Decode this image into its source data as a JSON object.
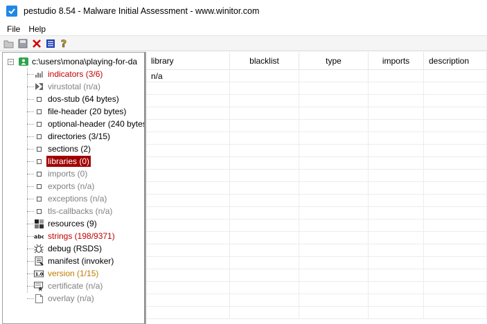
{
  "window": {
    "title": "pestudio 8.54 - Malware Initial Assessment - www.winitor.com"
  },
  "menu": [
    "File",
    "Help"
  ],
  "toolbar": {
    "buttons": [
      "open-icon",
      "save-icon",
      "close-icon",
      "list-icon",
      "help-icon"
    ]
  },
  "tree": {
    "root_label": "c:\\users\\mona\\playing-for-da",
    "items": [
      {
        "label": "indicators (3/6)",
        "icon": "bars-icon",
        "color": "red",
        "name": "indicators"
      },
      {
        "label": "virustotal (n/a)",
        "icon": "virustotal-icon",
        "color": "gray",
        "name": "virustotal"
      },
      {
        "label": "dos-stub (64 bytes)",
        "icon": "square-icon",
        "color": "black",
        "name": "dos-stub"
      },
      {
        "label": "file-header (20 bytes)",
        "icon": "square-icon",
        "color": "black",
        "name": "file-header"
      },
      {
        "label": "optional-header (240 bytes",
        "icon": "square-icon",
        "color": "black",
        "name": "optional-header"
      },
      {
        "label": "directories (3/15)",
        "icon": "square-icon",
        "color": "black",
        "name": "directories"
      },
      {
        "label": "sections (2)",
        "icon": "square-icon",
        "color": "black",
        "name": "sections"
      },
      {
        "label": "libraries (0)",
        "icon": "square-icon",
        "color": "selected",
        "name": "libraries"
      },
      {
        "label": "imports (0)",
        "icon": "square-icon",
        "color": "gray",
        "name": "imports"
      },
      {
        "label": "exports (n/a)",
        "icon": "square-icon",
        "color": "gray",
        "name": "exports"
      },
      {
        "label": "exceptions (n/a)",
        "icon": "square-icon",
        "color": "gray",
        "name": "exceptions"
      },
      {
        "label": "tls-callbacks (n/a)",
        "icon": "square-icon",
        "color": "gray",
        "name": "tls-callbacks"
      },
      {
        "label": "resources (9)",
        "icon": "resources-icon",
        "color": "black",
        "name": "resources"
      },
      {
        "label": "strings (198/9371)",
        "icon": "abc-icon",
        "color": "red",
        "name": "strings"
      },
      {
        "label": "debug (RSDS)",
        "icon": "bug-icon",
        "color": "black",
        "name": "debug"
      },
      {
        "label": "manifest (invoker)",
        "icon": "manifest-icon",
        "color": "black",
        "name": "manifest"
      },
      {
        "label": "version (1/15)",
        "icon": "version-icon",
        "color": "orange",
        "name": "version"
      },
      {
        "label": "certificate (n/a)",
        "icon": "certificate-icon",
        "color": "gray",
        "name": "certificate"
      },
      {
        "label": "overlay (n/a)",
        "icon": "page-icon",
        "color": "gray",
        "name": "overlay"
      }
    ]
  },
  "table": {
    "columns": [
      {
        "label": "library",
        "align": "left"
      },
      {
        "label": "blacklist",
        "align": "center"
      },
      {
        "label": "type",
        "align": "center"
      },
      {
        "label": "imports",
        "align": "center"
      },
      {
        "label": "description",
        "align": "left"
      }
    ],
    "rows": [
      [
        "n/a",
        "",
        "",
        "",
        ""
      ]
    ],
    "blank_row_count": 19
  },
  "colors": {
    "red": "#c00000",
    "gray": "#808080",
    "orange": "#c07a00",
    "selected_bg": "#a00000",
    "accent": "#1e88e5"
  }
}
